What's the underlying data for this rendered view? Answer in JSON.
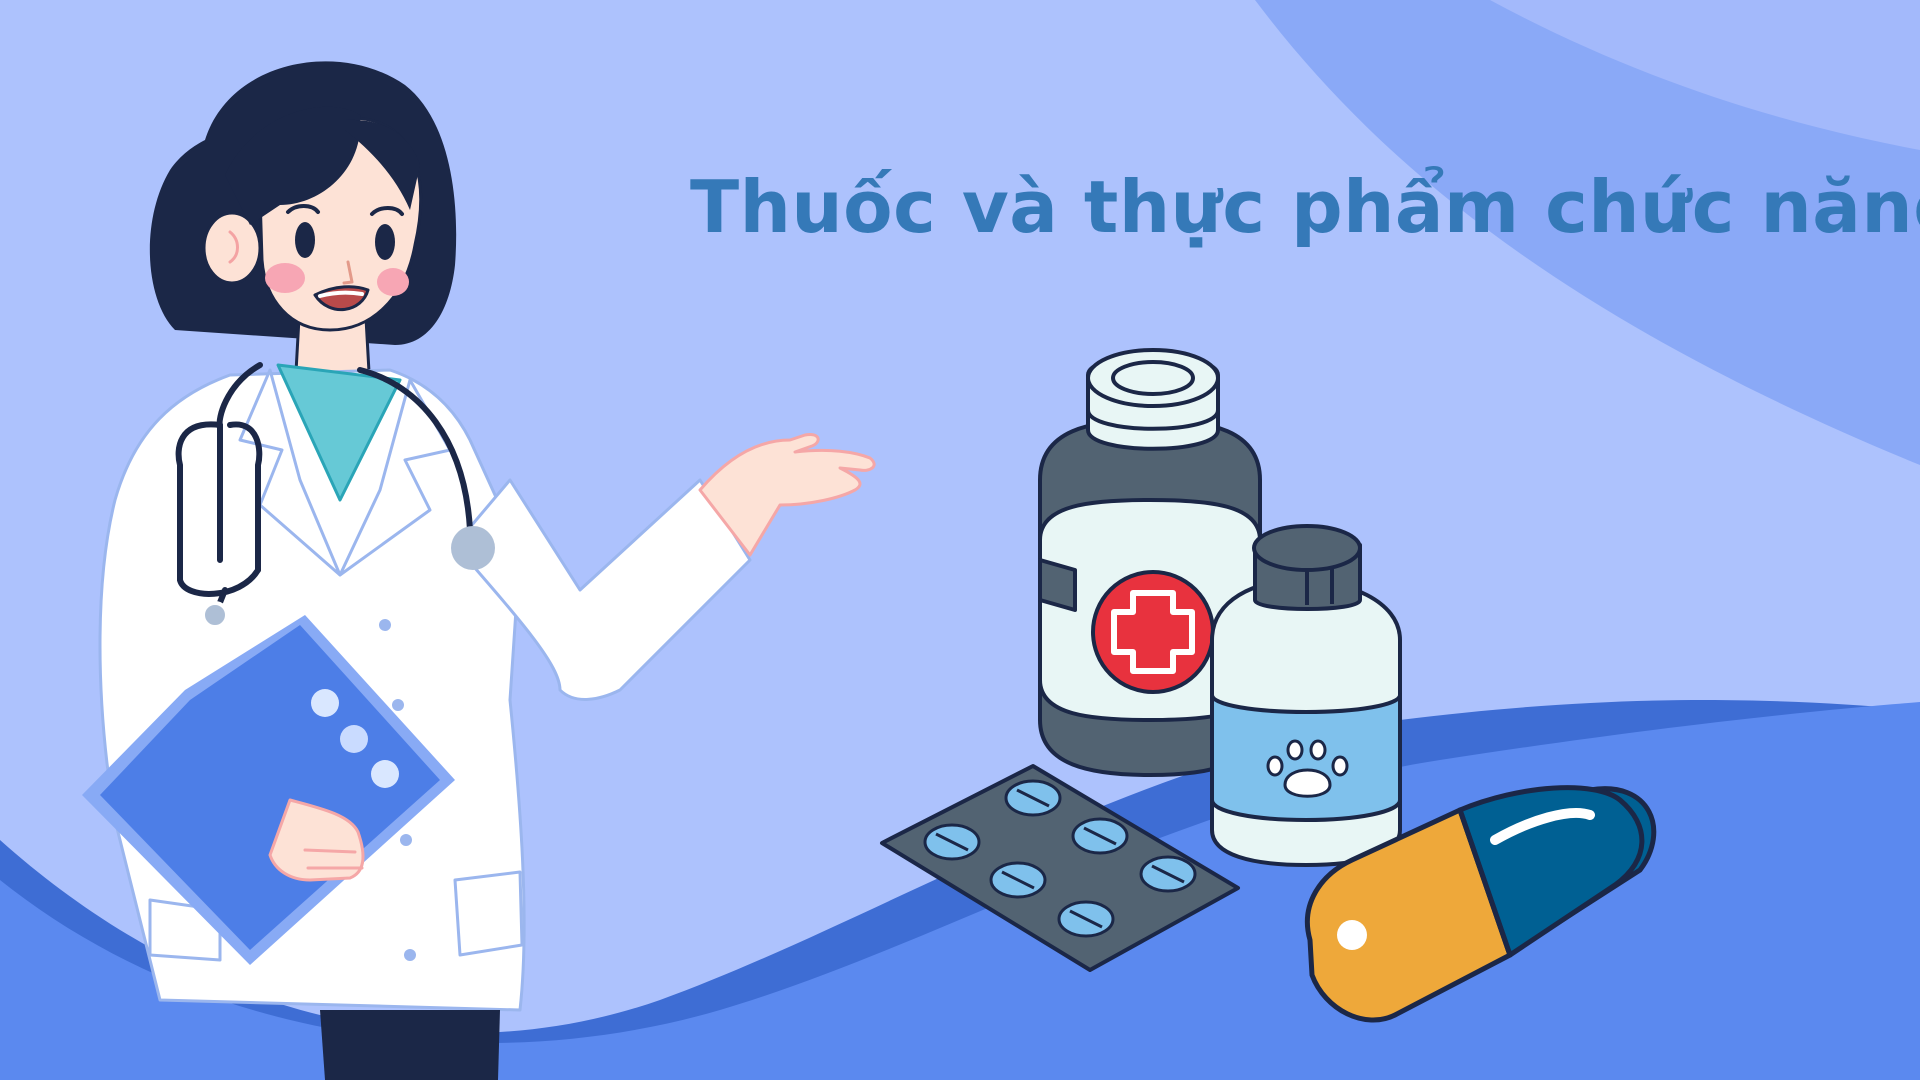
{
  "banner": {
    "title": "Thuốc và thực phẩm chức năng"
  },
  "colors": {
    "background": "#adc2fd",
    "wave_light": "#8aa9f7",
    "wave_dark": "#4f7ce9",
    "title": "#3579b8",
    "outline": "#1b2747",
    "pill_orange": "#eea83a",
    "pill_blue": "#006093",
    "cross_red": "#e8323e",
    "bottle_dark": "#526372"
  },
  "icons": {
    "doctor": "doctor-illustration-icon",
    "clipboard": "clipboard-icon",
    "stethoscope": "stethoscope-icon",
    "medicine_bottle": "medicine-bottle-icon",
    "pet_bottle": "pet-medicine-bottle-icon",
    "blister": "pill-blister-pack-icon",
    "capsule": "capsule-icon"
  }
}
